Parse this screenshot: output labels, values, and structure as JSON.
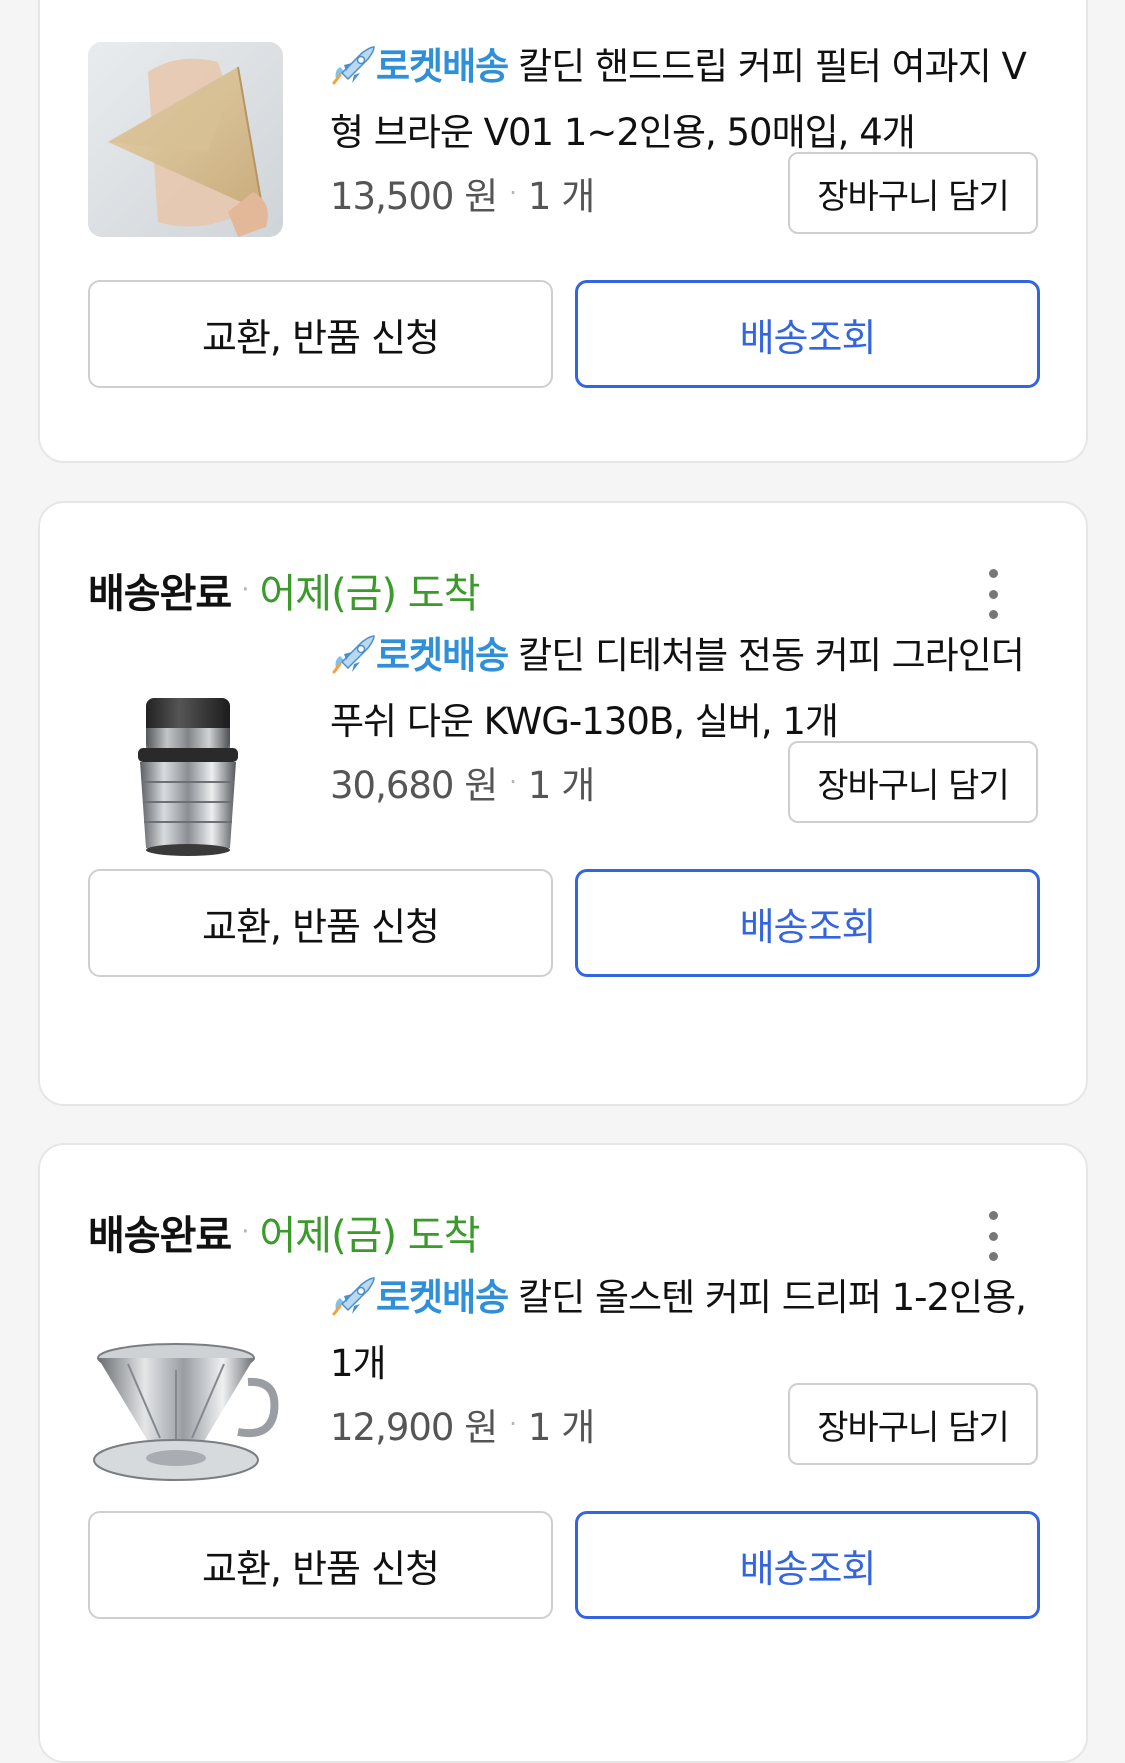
{
  "orders": [
    {
      "status": "",
      "arrival": "",
      "product": {
        "badge": "로켓배송",
        "name": "칼딘 핸드드립 커피 필터 여과지 V형 브라운 V01 1~2인용, 50매입, 4개",
        "price": "13,500 원",
        "quantity": "1 개",
        "image_icon": "coffee-filter-paper-image"
      },
      "cart_label": "장바구니 담기",
      "return_label": "교환, 반품 신청",
      "track_label": "배송조회"
    },
    {
      "status": "배송완료",
      "arrival": "어제(금) 도착",
      "product": {
        "badge": "로켓배송",
        "name": "칼딘 디테처블 전동 커피 그라인더 푸쉬 다운 KWG-130B, 실버, 1개",
        "price": "30,680 원",
        "quantity": "1 개",
        "image_icon": "coffee-grinder-image"
      },
      "cart_label": "장바구니 담기",
      "return_label": "교환, 반품 신청",
      "track_label": "배송조회"
    },
    {
      "status": "배송완료",
      "arrival": "어제(금) 도착",
      "product": {
        "badge": "로켓배송",
        "name": "칼딘 올스텐 커피 드리퍼 1-2인용, 1개",
        "price": "12,900 원",
        "quantity": "1 개",
        "image_icon": "coffee-dripper-image"
      },
      "cart_label": "장바구니 담기",
      "return_label": "교환, 반품 신청",
      "track_label": "배송조회"
    }
  ],
  "colors": {
    "arrival_green": "#3a9a2a",
    "rocket_blue": "#2f8fd8",
    "track_blue": "#3465e0"
  }
}
